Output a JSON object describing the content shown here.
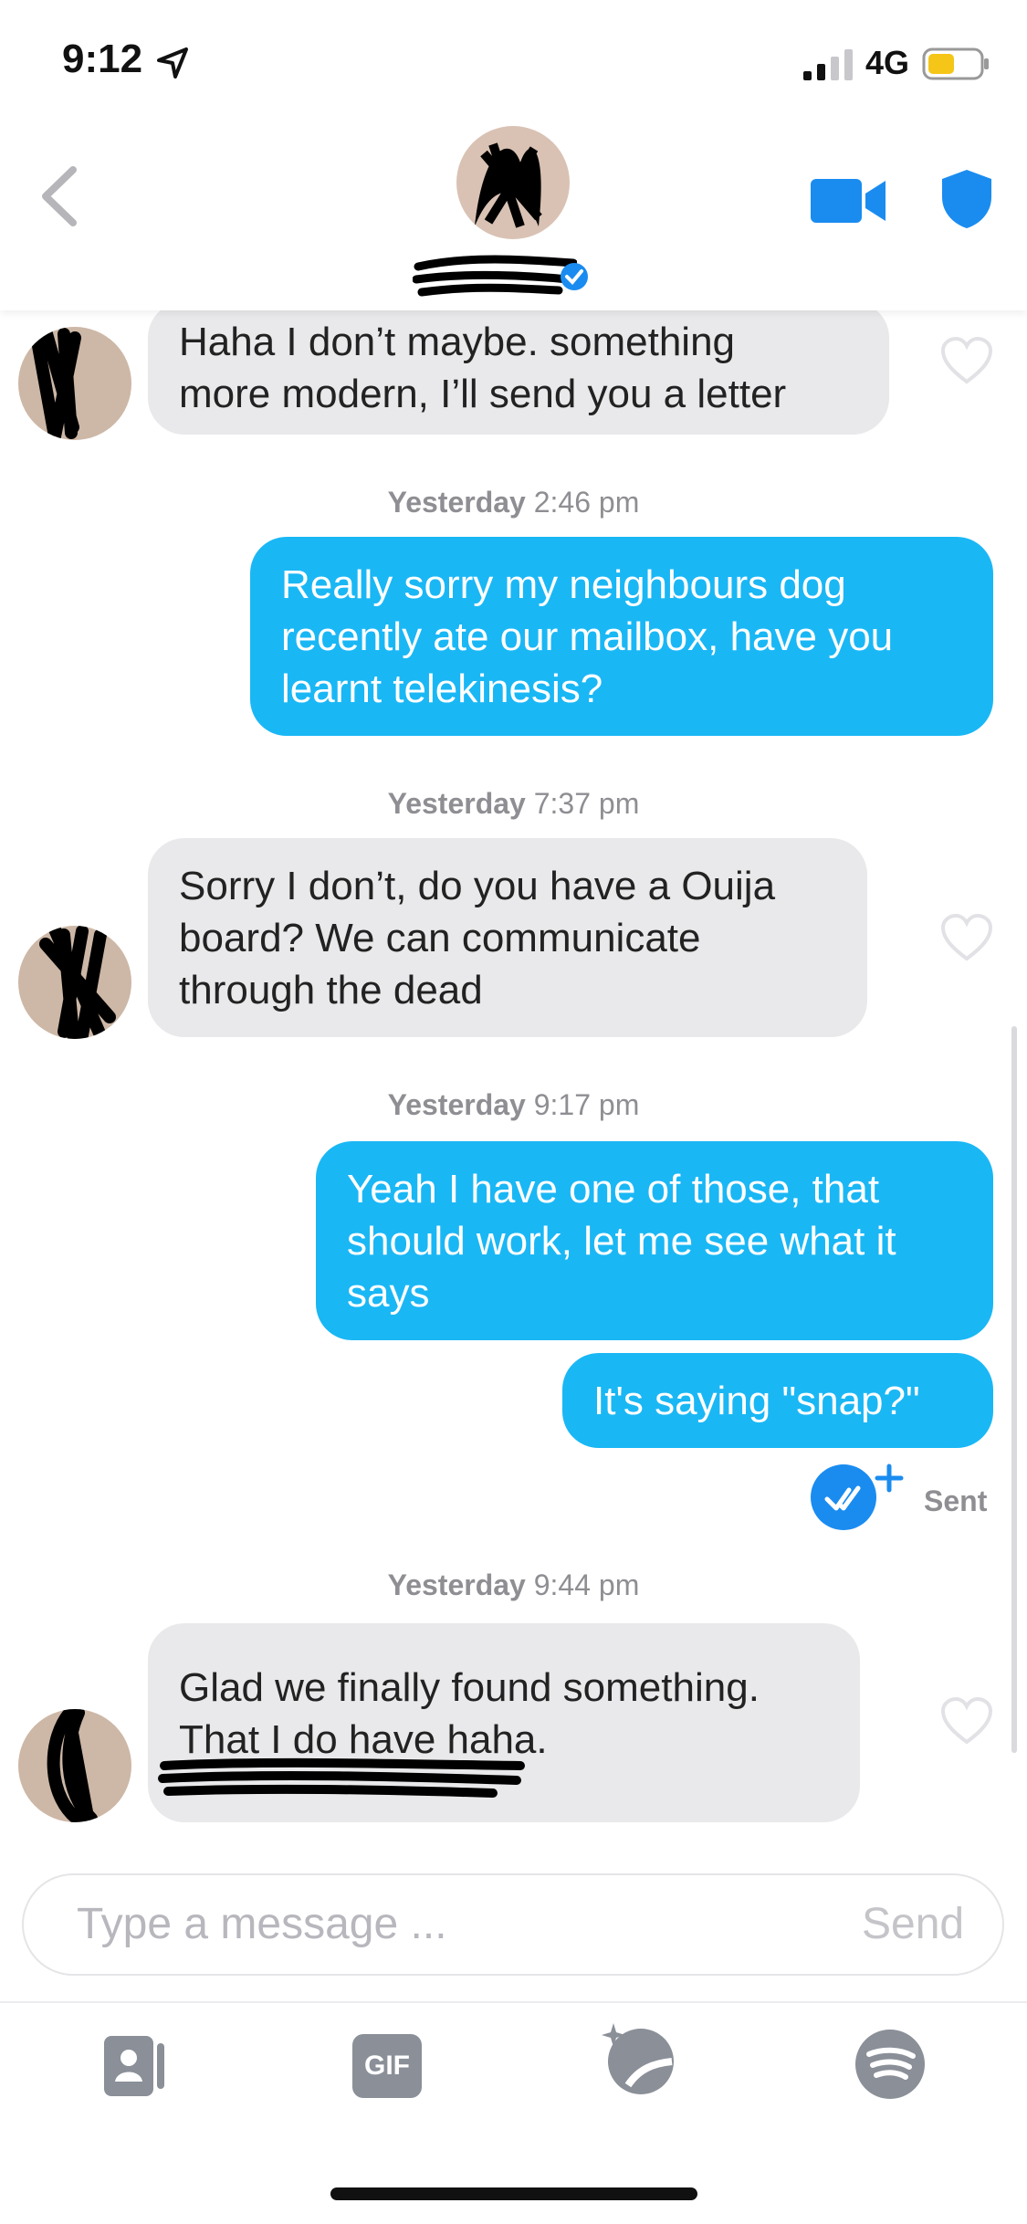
{
  "status_bar": {
    "time": "9:12",
    "network": "4G"
  },
  "header": {
    "buttons": [
      "back",
      "video-call",
      "safety-shield"
    ]
  },
  "messages": [
    {
      "id": "m1",
      "direction": "in",
      "lines": [
        "Haha I don’t maybe. something",
        "more modern, I’ll send you a letter"
      ]
    },
    {
      "id": "t1",
      "type": "timestamp",
      "day": "Yesterday",
      "time": "2:46 pm"
    },
    {
      "id": "m2",
      "direction": "out",
      "lines": [
        "Really sorry my neighbours dog",
        "recently ate our mailbox, have you",
        "learnt telekinesis?"
      ]
    },
    {
      "id": "t2",
      "type": "timestamp",
      "day": "Yesterday",
      "time": "7:37 pm"
    },
    {
      "id": "m3",
      "direction": "in",
      "lines": [
        "Sorry I don’t, do you have a Ouija",
        "board? We can communicate",
        "through the dead"
      ]
    },
    {
      "id": "t3",
      "type": "timestamp",
      "day": "Yesterday",
      "time": "9:17 pm"
    },
    {
      "id": "m4",
      "direction": "out",
      "lines": [
        "Yeah I have one of those, that",
        "should work, let me see what it",
        "says"
      ]
    },
    {
      "id": "m5",
      "direction": "out",
      "lines": [
        "It's saying \"snap?\""
      ]
    },
    {
      "id": "t4",
      "type": "timestamp",
      "day": "Yesterday",
      "time": "9:44 pm"
    },
    {
      "id": "m6",
      "direction": "in",
      "lines": [
        "Glad we finally found something.",
        "That I do have haha."
      ]
    }
  ],
  "sent_status": "Sent",
  "composer": {
    "placeholder": "Type a message ...",
    "send_label": "Send"
  },
  "toolbar": {
    "gif_label": "GIF",
    "items": [
      "contact-card",
      "gif",
      "sticker",
      "spotify"
    ]
  },
  "colors": {
    "outgoing": "#1ab7f5",
    "incoming": "#e9e9eb",
    "accent": "#1a8cf0",
    "timestamp": "#8e8e93"
  }
}
